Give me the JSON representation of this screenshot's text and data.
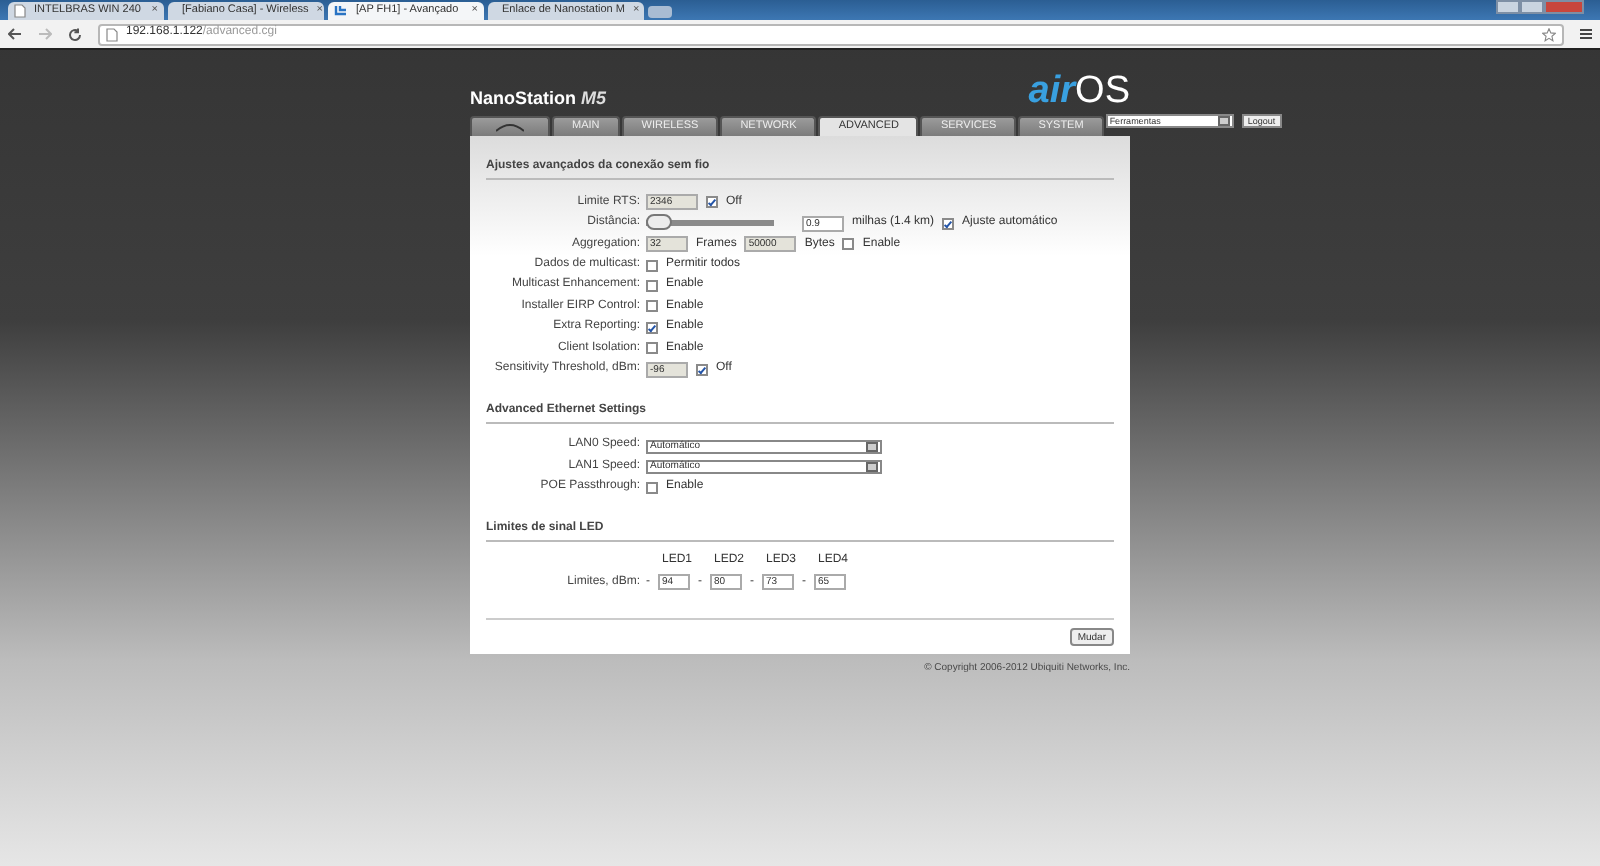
{
  "browser": {
    "tabs": [
      {
        "title": "INTELBRAS WIN 240",
        "kind": "page",
        "selected": false
      },
      {
        "title": "[Fabiano Casa] - Wireless",
        "kind": "ubnt",
        "selected": false
      },
      {
        "title": "[AP FH1] - Avançado",
        "kind": "ubnt",
        "selected": true
      },
      {
        "title": "Enlace de Nanostation M",
        "kind": "link",
        "selected": false
      }
    ],
    "close_glyph": "×",
    "address": {
      "host": "192.168.1.122",
      "path": "/advanced.cgi"
    }
  },
  "header": {
    "product": "NanoStation",
    "model": "M5",
    "logo_air": "air",
    "logo_os": "OS"
  },
  "nav_tabs": [
    {
      "kind": "icon",
      "selected": false
    },
    {
      "kind": "text",
      "label": "MAIN",
      "selected": false
    },
    {
      "kind": "text",
      "label": "WIRELESS",
      "selected": false
    },
    {
      "kind": "text",
      "label": "NETWORK",
      "selected": false
    },
    {
      "kind": "text",
      "label": "ADVANCED",
      "selected": true
    },
    {
      "kind": "text",
      "label": "SERVICES",
      "selected": false
    },
    {
      "kind": "text",
      "label": "SYSTEM",
      "selected": false
    }
  ],
  "tools": {
    "select": "Ferramentas",
    "button": "Logout"
  },
  "sections": [
    {
      "title": "Ajustes avançados da conexão sem fio",
      "rows": [
        {
          "label": "Limite RTS:",
          "controls": [
            {
              "kind": "input",
              "value": "2346",
              "disabled": true
            },
            {
              "kind": "checkbox",
              "label": "Off",
              "checked": true
            }
          ]
        },
        {
          "label": "Distância:",
          "controls": [
            {
              "kind": "slider",
              "level": 0.0
            },
            {
              "kind": "input",
              "value": "0.9",
              "disabled": false
            },
            {
              "kind": "text",
              "text": "milhas (1.4 km)"
            },
            {
              "kind": "checkbox",
              "label": "Ajuste automático",
              "checked": true
            }
          ]
        },
        {
          "label": "Aggregation:",
          "controls": [
            {
              "kind": "input",
              "value": "32",
              "disabled": true
            },
            {
              "kind": "text",
              "text": "Frames"
            },
            {
              "kind": "input",
              "value": "50000",
              "disabled": true
            },
            {
              "kind": "text",
              "text": "Bytes"
            },
            {
              "kind": "checkbox",
              "label": "Enable",
              "checked": false
            }
          ]
        },
        {
          "label": "Dados de multicast:",
          "controls": [
            {
              "kind": "checkbox",
              "label": "Permitir todos",
              "checked": false
            }
          ]
        },
        {
          "label": "Multicast Enhancement:",
          "controls": [
            {
              "kind": "checkbox",
              "label": "Enable",
              "checked": false
            }
          ]
        },
        {
          "label": "Installer EIRP Control:",
          "controls": [
            {
              "kind": "checkbox",
              "label": "Enable",
              "checked": false
            }
          ]
        },
        {
          "label": "Extra Reporting:",
          "controls": [
            {
              "kind": "checkbox",
              "label": "Enable",
              "checked": true
            }
          ]
        },
        {
          "label": "Client Isolation:",
          "controls": [
            {
              "kind": "checkbox",
              "label": "Enable",
              "checked": false
            }
          ]
        },
        {
          "label": "Sensitivity Threshold, dBm:",
          "controls": [
            {
              "kind": "input",
              "value": "-96",
              "disabled": true
            },
            {
              "kind": "checkbox",
              "label": "Off",
              "checked": true
            }
          ]
        }
      ]
    },
    {
      "title": "Advanced Ethernet Settings",
      "rows": [
        {
          "label": "LAN0 Speed:",
          "controls": [
            {
              "kind": "select",
              "value": "Automático"
            }
          ]
        },
        {
          "label": "LAN1 Speed:",
          "controls": [
            {
              "kind": "select",
              "value": "Automático"
            }
          ]
        },
        {
          "label": "POE Passthrough:",
          "controls": [
            {
              "kind": "checkbox",
              "label": "Enable",
              "checked": false
            }
          ]
        }
      ]
    },
    {
      "title": "Limites de sinal LED",
      "rows": [
        {
          "label": "Limites, dBm:",
          "controls": [
            {
              "kind": "led",
              "caption": "LED1",
              "dash": "-",
              "value": "94"
            },
            {
              "kind": "led",
              "caption": "LED2",
              "dash": "-",
              "value": "80"
            },
            {
              "kind": "led",
              "caption": "LED3",
              "dash": "-",
              "value": "73"
            },
            {
              "kind": "led",
              "caption": "LED4",
              "dash": "-",
              "value": "65"
            }
          ]
        }
      ]
    }
  ],
  "submit": "Mudar",
  "copyright": "© Copyright 2006-2012 Ubiquiti Networks, Inc."
}
